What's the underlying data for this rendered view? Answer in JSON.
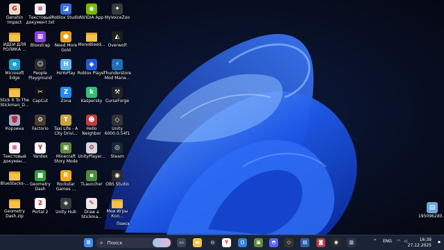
{
  "desktop": {
    "icons": [
      {
        "label": "Genshin Impact",
        "icon": "genshin-icon",
        "bg": "#e8dcc8",
        "glyph": "G"
      },
      {
        "label": "Текстовый документ.txt",
        "icon": "text-file-icon",
        "bg": "#eef2f6",
        "glyph": "≡"
      },
      {
        "label": "Roblox Studio",
        "icon": "roblox-studio-icon",
        "bg": "#2f6fd6",
        "glyph": "◪"
      },
      {
        "label": "NVIDIA App",
        "icon": "nvidia-icon",
        "bg": "#76b900",
        "glyph": "◉"
      },
      {
        "label": "MyVoiceZoo",
        "icon": "myvoicezoo-icon",
        "bg": "#3a3a3a",
        "glyph": "✦"
      },
      {
        "label": "ИДЕИ ДЛЯ РОЛИКА ...",
        "icon": "folder-icon",
        "bg": "#f4c24a",
        "glyph": ""
      },
      {
        "label": "Bloxstrap",
        "icon": "bloxstrap-icon",
        "bg": "#8b3fd9",
        "glyph": "▦"
      },
      {
        "label": "Need More Gold",
        "icon": "need-more-gold-icon",
        "bg": "#e9a21c",
        "glyph": "●"
      },
      {
        "label": "MonoBleed...",
        "icon": "folder-icon",
        "bg": "#f4c24a",
        "glyph": ""
      },
      {
        "label": "Overwolf",
        "icon": "overwolf-icon",
        "bg": "#1e1e1e",
        "glyph": "◭"
      },
      {
        "label": "Microsoft Edge",
        "icon": "edge-icon",
        "bg": "#1aa0c9",
        "glyph": "e"
      },
      {
        "label": "People Playground",
        "icon": "people-playground-icon",
        "bg": "#2b2b2b",
        "glyph": "☺"
      },
      {
        "label": "HoYoPlay",
        "icon": "hoyoplay-icon",
        "bg": "#5fb4f2",
        "glyph": "H"
      },
      {
        "label": "Roblox Player",
        "icon": "roblox-player-icon",
        "bg": "#1f5ad8",
        "glyph": "◆"
      },
      {
        "label": "Thunderstore Mod Mana...",
        "icon": "thunderstore-icon",
        "bg": "#1d6fb7",
        "glyph": "⚡"
      },
      {
        "label": "Stick It To The Stickman_D...",
        "icon": "folder-icon",
        "bg": "#f4c24a",
        "glyph": ""
      },
      {
        "label": "CapCut",
        "icon": "capcut-icon",
        "bg": "#111111",
        "glyph": "✂"
      },
      {
        "label": "Zona",
        "icon": "zona-icon",
        "bg": "#1f8ef2",
        "glyph": "Z"
      },
      {
        "label": "Kaspersky",
        "icon": "kaspersky-icon",
        "bg": "#2dbf73",
        "glyph": "k"
      },
      {
        "label": "CurseForge",
        "icon": "curseforge-icon",
        "bg": "#222222",
        "glyph": "⚒"
      },
      {
        "label": "Корзина",
        "icon": "recycle-bin-icon",
        "bg": "#9eb0c4",
        "glyph": "🗑"
      },
      {
        "label": "Factorio",
        "icon": "factorio-icon",
        "bg": "#4a3a2a",
        "glyph": "⚙"
      },
      {
        "label": "Taxi Life - A City Drivi...",
        "icon": "taxi-life-icon",
        "bg": "#c7a43a",
        "glyph": "T"
      },
      {
        "label": "Hello Neighbor",
        "icon": "hello-neighbor-icon",
        "bg": "#c23b3b",
        "glyph": "☻"
      },
      {
        "label": "Unity 6000.0.54f1",
        "icon": "unity-icon",
        "bg": "#333333",
        "glyph": "◇"
      },
      {
        "label": "Текстовый докумен...",
        "icon": "text-file-icon",
        "bg": "#eef2f6",
        "glyph": "≡"
      },
      {
        "label": "Yandex",
        "icon": "yandex-icon",
        "bg": "#ffffff",
        "glyph": "Y"
      },
      {
        "label": "Minecraft Story Mode",
        "icon": "minecraft-story-mode-icon",
        "bg": "#5e8a3a",
        "glyph": "▣"
      },
      {
        "label": "UnityPlayer...",
        "icon": "unity-player-icon",
        "bg": "#d0d6de",
        "glyph": "⚙"
      },
      {
        "label": "Steam",
        "icon": "steam-icon",
        "bg": "#1b2838",
        "glyph": "◎"
      },
      {
        "label": "BlueStacks-...",
        "icon": "folder-icon",
        "bg": "#f4c24a",
        "glyph": ""
      },
      {
        "label": "Geometry Dash",
        "icon": "geometry-dash-icon",
        "bg": "#2f9e3a",
        "glyph": "■"
      },
      {
        "label": "Rockstar Games ...",
        "icon": "rockstar-games-icon",
        "bg": "#f1a81c",
        "glyph": "R"
      },
      {
        "label": "TLauncher",
        "icon": "tlauncher-icon",
        "bg": "#4c8a3a",
        "glyph": "▪"
      },
      {
        "label": "OBS Studio",
        "icon": "obs-icon",
        "bg": "#2b2b2b",
        "glyph": "◉"
      },
      {
        "label": "Geometry Dash.zip",
        "icon": "folder-zip-icon",
        "bg": "#f4c24a",
        "glyph": ""
      },
      {
        "label": "Portal 2",
        "icon": "portal2-icon",
        "bg": "#ffffff",
        "glyph": "2"
      },
      {
        "label": "Unity Hub",
        "icon": "unity-hub-icon",
        "bg": "#3a3a3a",
        "glyph": "◈"
      },
      {
        "label": "Draw a Stickma...",
        "icon": "draw-a-stickman-icon",
        "bg": "#e8e8e8",
        "glyph": "✎"
      },
      {
        "label": "Мои Игры Кол...",
        "icon": "folder-icon",
        "bg": "#f4c24a",
        "glyph": ""
      },
      {
        "label": "1950962d0...",
        "icon": "image-file-icon",
        "bg": "#6da7d8",
        "glyph": "▤"
      }
    ]
  },
  "taskbar": {
    "search_placeholder": "Поиск",
    "tooltip": "Поиск",
    "pinned": [
      {
        "icon": "start-icon",
        "bg": "#3d8df0",
        "glyph": "⊞"
      },
      {
        "icon": "task-view-icon",
        "bg": "#3b4458",
        "glyph": "▭"
      },
      {
        "icon": "file-explorer-icon",
        "bg": "#f4c24a",
        "glyph": "▬"
      },
      {
        "icon": "steam-icon",
        "bg": "#1b2838",
        "glyph": "◎"
      },
      {
        "icon": "yandex-icon",
        "bg": "#ffffff",
        "glyph": "Y"
      },
      {
        "icon": "vscode-icon",
        "bg": "#2f7fd6",
        "glyph": "⟨⟩"
      },
      {
        "icon": "minecraft-icon",
        "bg": "#5e8a3a",
        "glyph": "▣"
      },
      {
        "icon": "discord-icon",
        "bg": "#5865f2",
        "glyph": "◓"
      },
      {
        "icon": "unity-icon",
        "bg": "#333333",
        "glyph": "◇"
      },
      {
        "icon": "app-icon",
        "bg": "#2a5fb0",
        "glyph": "▤"
      },
      {
        "icon": "game-icon",
        "bg": "#b53a48",
        "glyph": "◙"
      },
      {
        "icon": "obs-icon",
        "bg": "#2b2b2b",
        "glyph": "◉"
      },
      {
        "icon": "chart-icon",
        "bg": "#2d3446",
        "glyph": "▥"
      }
    ],
    "tray": {
      "chevron": "^",
      "language": "ENG",
      "time": "16:39",
      "date": "27.12.2025"
    }
  }
}
